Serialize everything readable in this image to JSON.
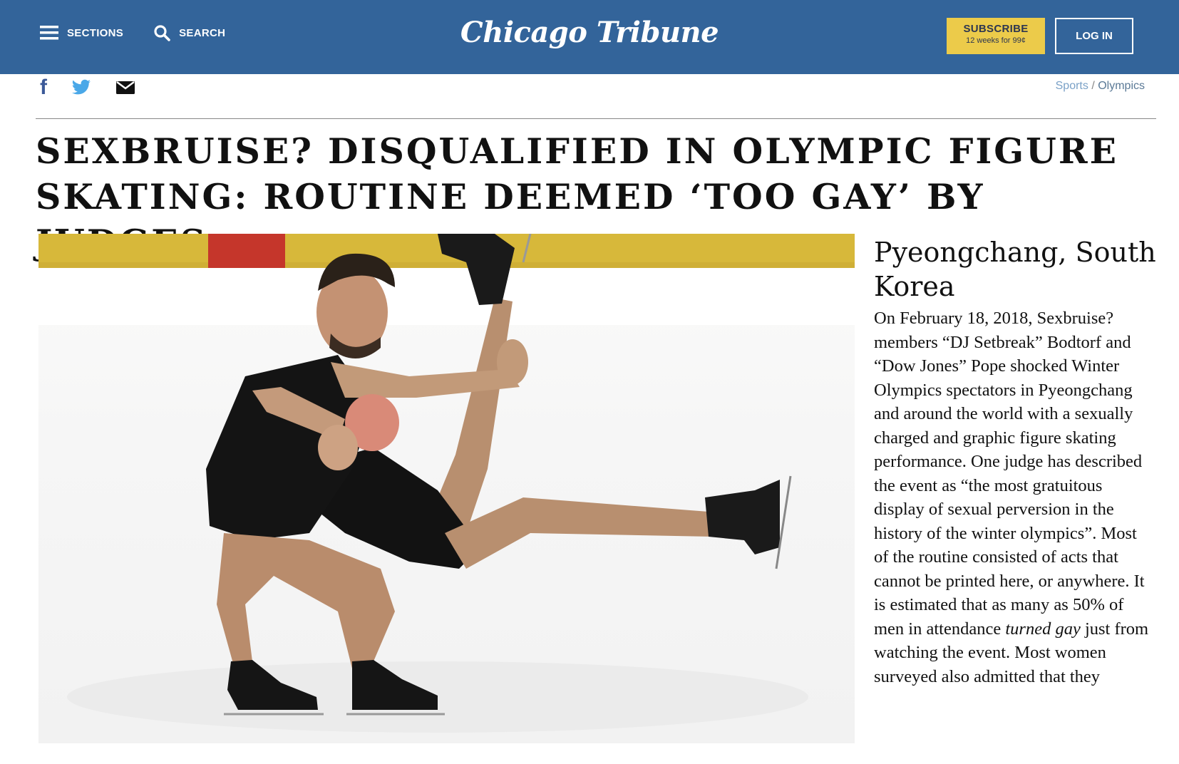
{
  "header": {
    "sections_label": "SECTIONS",
    "search_label": "SEARCH",
    "logo": "Chicago Tribune",
    "subscribe_label": "SUBSCRIBE",
    "subscribe_offer": "12 weeks for 99¢",
    "login_label": "LOG IN",
    "brand_color": "#33649a",
    "subscribe_color": "#eccb4a"
  },
  "share": {
    "facebook_icon": "f",
    "icons": [
      "facebook-icon",
      "twitter-icon",
      "email-icon"
    ]
  },
  "breadcrumb": {
    "section": "Sports",
    "separator": " / ",
    "subsection": "Olympics"
  },
  "article": {
    "headline": "Sexbruise? Disqualified in Olympic Figure Skating: Routine Deemed ‘Too Gay’ by Judges",
    "dateline": "Pyeongchang, South Korea",
    "body_before": "On February 18, 2018, Sexbruise? members “DJ Setbreak” Bodtorf and “Dow Jones” Pope shocked Winter Olympics spectators in Pyeongchang and around the world with a sexually charged and graphic figure skating performance. One judge has described the event as “the most gratuitous display of sexual perversion in the history of the winter olympics”. Most of the routine consisted of acts that cannot be printed here, or anywhere. It is estimated that as many as 50% of men in attendance ",
    "body_emphasis": "turned gay",
    "body_after": " just from watching the event. Most women surveyed also admitted that they"
  }
}
